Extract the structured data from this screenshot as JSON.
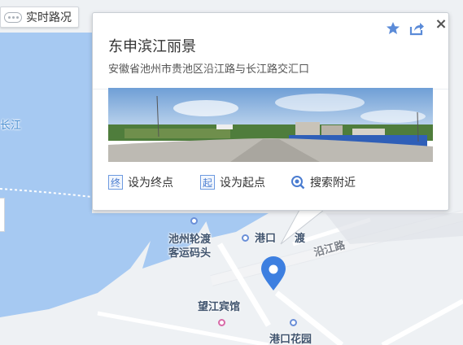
{
  "map": {
    "labels": {
      "river": "长江",
      "ferry_terminal": "池州轮渡",
      "ferry_terminal_line2": "客运码头",
      "port_ferry": "港口轮渡",
      "port_ferry_visible": "港口",
      "port_ferry_visible_tail": "渡",
      "road": "沿江路",
      "hotel": "望江宾馆",
      "garden": "港口花园"
    },
    "colors": {
      "water": "#a6c9f2",
      "land": "#eef1f4",
      "road": "#ffffff",
      "marker": "#3d7fe0"
    }
  },
  "traffic_button": {
    "label": "实时路况",
    "icon": "traffic-icon"
  },
  "popup": {
    "title": "东申滨江丽景",
    "address": "安徽省池州市贵池区沿江路与长江路交汇口",
    "photo": "street-view-panorama",
    "actions": [
      {
        "badge": "终",
        "label": "设为终点"
      },
      {
        "badge": "起",
        "label": "设为起点"
      },
      {
        "badge": "search-icon",
        "label": "搜索附近"
      }
    ],
    "icons": {
      "favorite": "star-icon",
      "share": "share-icon",
      "close": "close-icon",
      "close_glyph": "×"
    }
  }
}
